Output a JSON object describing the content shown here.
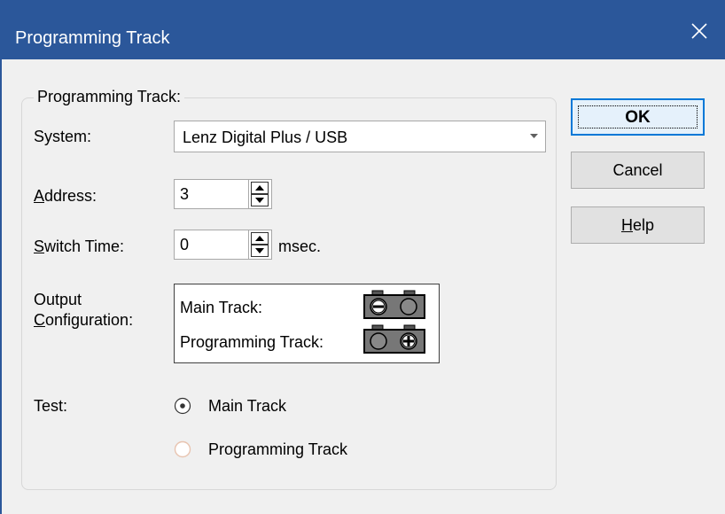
{
  "window": {
    "title": "Programming Track"
  },
  "group": {
    "label": "Programming Track:"
  },
  "system": {
    "label": "System:",
    "value": "Lenz Digital Plus / USB"
  },
  "address": {
    "label_first": "A",
    "label_rest": "ddress:",
    "value": "3"
  },
  "switch_time": {
    "label_first": "S",
    "label_rest": "witch Time:",
    "value": "0",
    "unit": "msec."
  },
  "output": {
    "label_line1": "Output",
    "label_line2_first": "C",
    "label_line2_rest": "onfiguration:",
    "main_track": "Main Track:",
    "programming_track": "Programming Track:"
  },
  "test": {
    "label": "Test:",
    "options": [
      {
        "label": "Main Track",
        "selected": true
      },
      {
        "label": "Programming Track",
        "selected": false
      }
    ]
  },
  "buttons": {
    "ok": "OK",
    "cancel": "Cancel",
    "help_first": "H",
    "help_rest": "elp"
  },
  "colors": {
    "titlebar": "#2b579a",
    "background": "#f0f0f0",
    "ok_border": "#0078d7",
    "terminal_fill": "#777777"
  }
}
